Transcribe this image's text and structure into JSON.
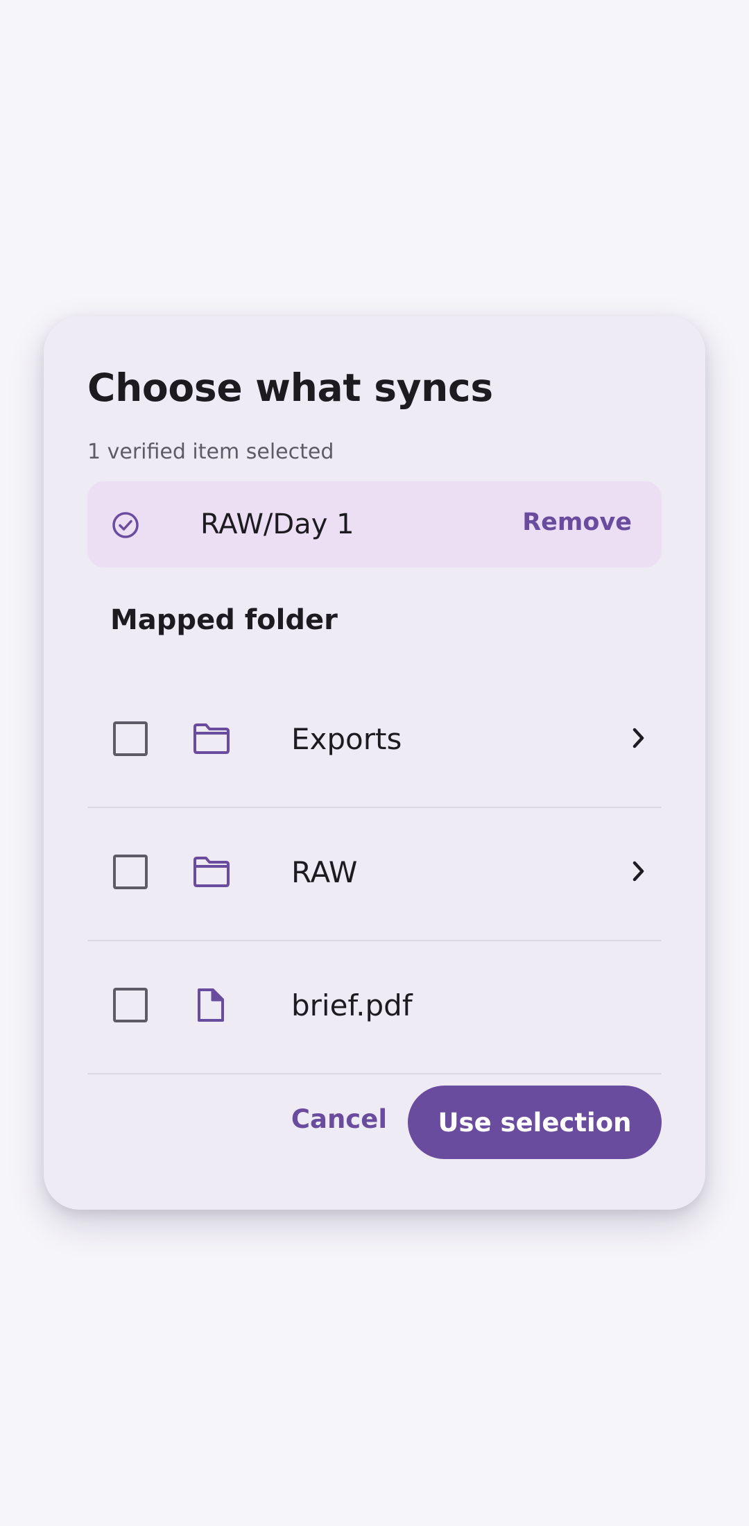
{
  "dialog": {
    "title": "Choose what syncs",
    "subtitle": "1 verified item selected"
  },
  "selected": {
    "label": "RAW/Day 1",
    "remove_label": "Remove",
    "icon": "check-circle-icon"
  },
  "section": {
    "header": "Mapped folder"
  },
  "items": [
    {
      "label": "Exports",
      "icon": "folder-icon",
      "has_chevron": true,
      "checked": false
    },
    {
      "label": "RAW",
      "icon": "folder-icon",
      "has_chevron": true,
      "checked": false
    },
    {
      "label": "brief.pdf",
      "icon": "file-icon",
      "has_chevron": false,
      "checked": false
    }
  ],
  "actions": {
    "cancel_label": "Cancel",
    "confirm_label": "Use selection"
  },
  "colors": {
    "accent": "#6a4c9e",
    "chip_background": "#ecdef3",
    "dialog_background": "#efebf5",
    "page_background": "#f6f5fa",
    "text": "#1d1b20",
    "muted_text": "#5f5b66",
    "divider": "#dcd8e0"
  }
}
